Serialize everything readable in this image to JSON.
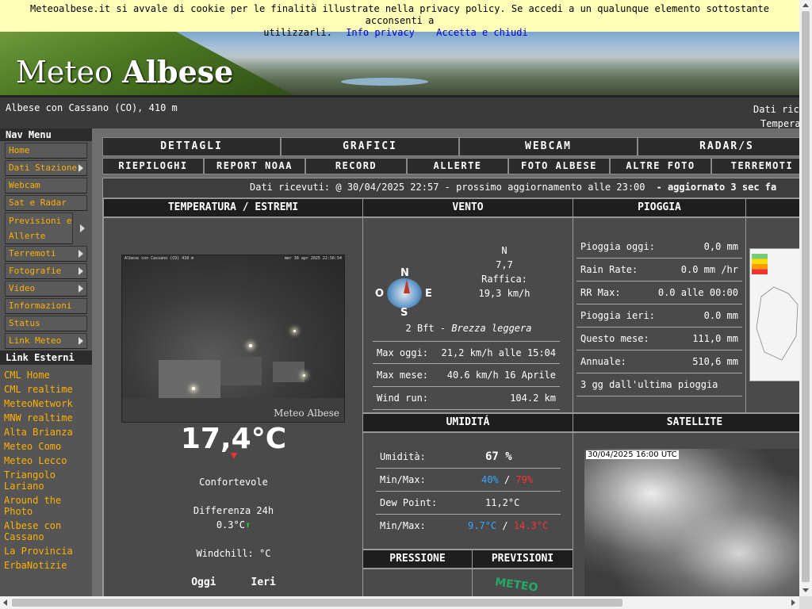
{
  "cookie": {
    "text": "Meteoalbese.it si avvale di cookie per le finalità illustrate nella privacy policy. Se accedi a un qualunque elemento sottostante acconsenti al loro utilizzo.",
    "line1": "Meteoalbese.it si avvale di cookie per le finalità illustrate nella privacy policy. Se accedi a un qualunque elemento sottostante acconsenti a",
    "line2_prefix": "utilizzarli.",
    "privacy_link": "Info privacy",
    "accept_link": "Accetta e chiudi"
  },
  "banner": {
    "logo_light": "Meteo ",
    "logo_bold": "Albese"
  },
  "location": {
    "text": "Albese con Cassano (CO), 410 m",
    "right_line1": "Dati ric",
    "right_line2": "Tempera"
  },
  "sidebar": {
    "nav_title": "Nav Menu",
    "items": [
      {
        "label": "Home",
        "submenu": false
      },
      {
        "label": "Dati Stazione",
        "submenu": true
      },
      {
        "label": "Webcam",
        "submenu": false
      },
      {
        "label": "Sat e Radar",
        "submenu": false
      },
      {
        "label": "Previsioni e Allerte",
        "submenu": true
      },
      {
        "label": "Terremoti",
        "submenu": true
      },
      {
        "label": "Fotografie",
        "submenu": true
      },
      {
        "label": "Video",
        "submenu": true
      },
      {
        "label": "Informazioni",
        "submenu": false
      },
      {
        "label": "Status",
        "submenu": false
      },
      {
        "label": "Link Meteo",
        "submenu": true
      }
    ],
    "ext_title": "Link Esterni",
    "ext_links": [
      "CML Home",
      "CML realtime",
      "MeteoNetwork",
      "MNW realtime",
      "Alta Brianza",
      "Meteo Como",
      "Meteo Lecco",
      "Triangolo Lariano",
      "Around the Photo",
      "Albese con Cassano",
      "La Provincia",
      "ErbaNotizie"
    ]
  },
  "tabs_row1": [
    "DETTAGLI",
    "GRAFICI",
    "WEBCAM",
    "RADAR/S"
  ],
  "tabs_row2": [
    "RIEPILOGHI",
    "REPORT NOAA",
    "RECORD",
    "ALLERTE",
    "FOTO ALBESE",
    "ALTRE FOTO",
    "TERREMOTI"
  ],
  "status": {
    "text": "Dati ricevuti: @ 30/04/2025 22:57 - prossimo aggiornamento alle 23:00",
    "updated": "- aggiornato 3 sec fa"
  },
  "temperature": {
    "header": "TEMPERATURA / ESTREMI",
    "webcam_caption": "Albese con Cassano (CO) 410 m",
    "webcam_time": "mer 30 apr 2025 22:56:54",
    "webcam_watermark": "Meteo Albese",
    "value": "17,4°C",
    "comfort": "Confortevole",
    "diff_label": "Differenza 24h",
    "diff_value": "0.3°C",
    "diff_arrow": "⬆",
    "windchill": "Windchill: °C",
    "today": "Oggi",
    "yesterday": "Ieri"
  },
  "wind": {
    "header": "VENTO",
    "compass": {
      "n": "N",
      "e": "E",
      "s": "S",
      "o": "O"
    },
    "direction": "N",
    "speed": "7,7",
    "gust_label": "Raffica:",
    "gust_value": "19,3 km/h",
    "beaufort": "2 Bft -",
    "beaufort_desc": "Brezza leggera",
    "rows": [
      {
        "k": "Max oggi:",
        "v": "21,2 km/h alle 15:04"
      },
      {
        "k": "Max mese:",
        "v": "40.6 km/h 16 Aprile"
      },
      {
        "k": "Wind run:",
        "v": "104.2 km"
      }
    ]
  },
  "rain": {
    "header": "PIOGGIA",
    "rows": [
      {
        "k": "Pioggia oggi:",
        "v": "0,0 mm"
      },
      {
        "k": "Rain Rate:",
        "v": "0.0 mm /hr"
      },
      {
        "k": "RR Max:",
        "v": "0.0 alle 00:00"
      },
      {
        "k": "Pioggia ieri:",
        "v": "0.0 mm"
      },
      {
        "k": "Questo mese:",
        "v": "111,0 mm"
      },
      {
        "k": "Annuale:",
        "v": "510,6 mm"
      }
    ],
    "last_rain": "3 gg dall'ultima pioggia"
  },
  "humidity": {
    "header": "UMIDITÁ",
    "label": "Umidità:",
    "value": "67 %",
    "minmax_label": "Min/Max:",
    "min": "40%",
    "max": "79%",
    "sep": "/",
    "dew_label": "Dew Point:",
    "dew_value": "11,2°C",
    "dew_minmax_label": "Min/Max:",
    "dew_min": "9.7°C",
    "dew_max": "14.3°C"
  },
  "satellite": {
    "header": "SATELLITE",
    "timestamp": "30/04/2025 16:00 UTC"
  },
  "pressure": {
    "header": "PRESSIONE"
  },
  "forecast": {
    "header": "PREVISIONI",
    "logo_text": "METEO"
  },
  "colors": {
    "accent_orange": "#ffb000",
    "min_blue": "#33aaff",
    "max_red": "#ff3333",
    "cookie_bg": "#fffeb8"
  }
}
